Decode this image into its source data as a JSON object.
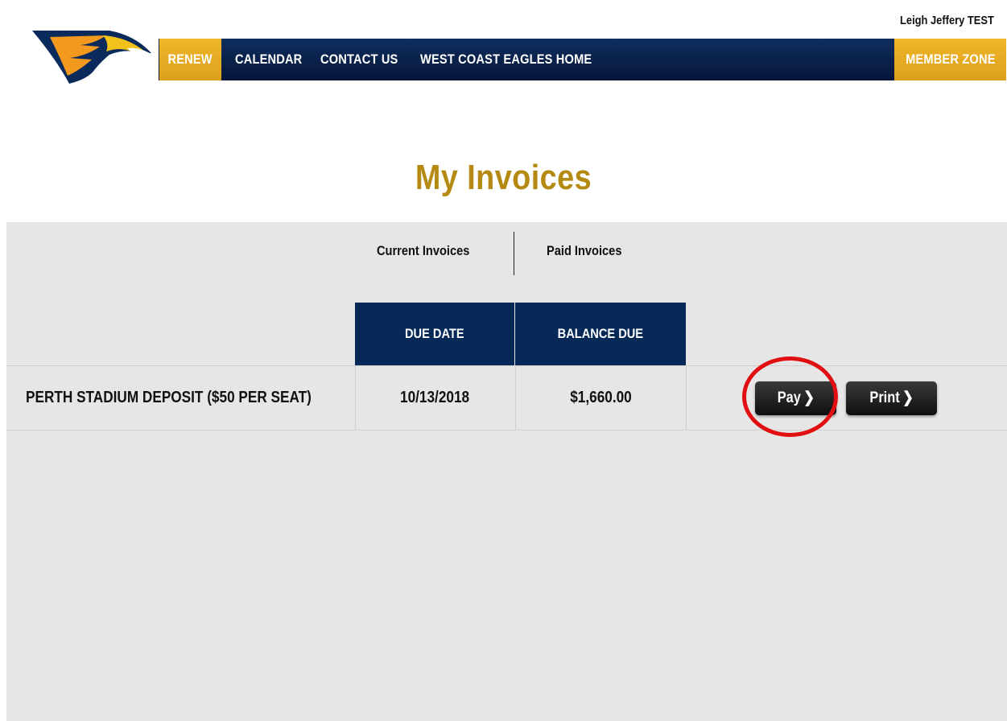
{
  "header": {
    "user_name": "Leigh Jeffery TEST",
    "nav": {
      "renew": "RENEW",
      "calendar": "CALENDAR",
      "contact_us": "CONTACT US",
      "home": "WEST COAST EAGLES HOME",
      "member_zone": "MEMBER ZONE"
    }
  },
  "page_title": "My Invoices",
  "tabs": {
    "current": "Current Invoices",
    "paid": "Paid Invoices"
  },
  "table": {
    "columns": [
      "DUE DATE",
      "BALANCE DUE"
    ],
    "rows": [
      {
        "description": "PERTH STADIUM DEPOSIT ($50 PER SEAT)",
        "due_date": "10/13/2018",
        "balance_due": "$1,660.00",
        "actions": {
          "pay": "Pay",
          "print": "Print"
        }
      }
    ]
  },
  "colors": {
    "navy": "#062957",
    "gold": "#f2b62b",
    "title_gold": "#b58a12",
    "panel_bg": "#e6e6e6",
    "highlight_red": "#e20f12"
  },
  "icons": {
    "logo": "eagle-logo-icon",
    "chevron": "chevron-right-icon"
  }
}
